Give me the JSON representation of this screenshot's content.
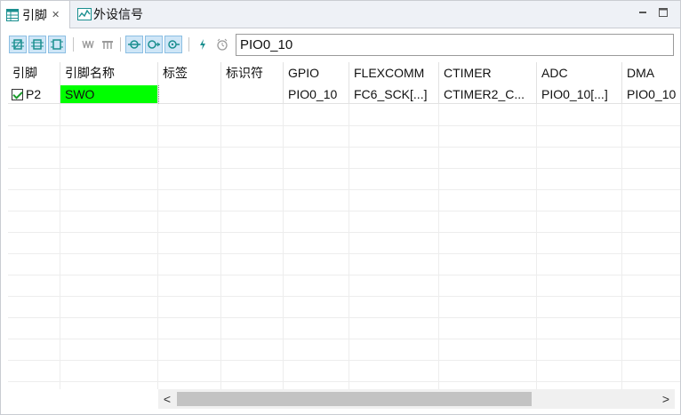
{
  "tabs": [
    {
      "label": "引脚",
      "icon": "table-icon",
      "active": true
    },
    {
      "label": "外设信号",
      "icon": "signal-chart-icon",
      "active": false
    }
  ],
  "toolbar": {
    "icons_group1": [
      "pin-view-icon",
      "pin-row-icon",
      "pin-package-icon"
    ],
    "icons_group2": [
      "waveform-icon",
      "signal-bus-icon"
    ],
    "icons_group3": [
      "filter-routed-icon",
      "filter-output-icon",
      "filter-input-icon"
    ],
    "icons_group4": [
      "power-icon",
      "clock-icon"
    ],
    "search_value": "PIO0_10"
  },
  "table": {
    "columns": [
      "引脚",
      "引脚名称",
      "标签",
      "标识符",
      "GPIO",
      "FLEXCOMM",
      "CTIMER",
      "ADC",
      "DMA"
    ],
    "rows": [
      {
        "checked": true,
        "pin": "P2",
        "pin_name": "SWO",
        "label": "",
        "identifier": "",
        "gpio": "PIO0_10",
        "flexcomm": "FC6_SCK[...]",
        "ctimer": "CTIMER2_C...",
        "adc": "PIO0_10[...]",
        "dma": "PIO0_10"
      }
    ]
  },
  "colors": {
    "pin_name_highlight": "#00ff00",
    "pressed_button": "#cfe6f7",
    "accent_icon": "#1a8f8f"
  },
  "scrollbar": {
    "left_arrow": "<",
    "right_arrow": ">"
  }
}
